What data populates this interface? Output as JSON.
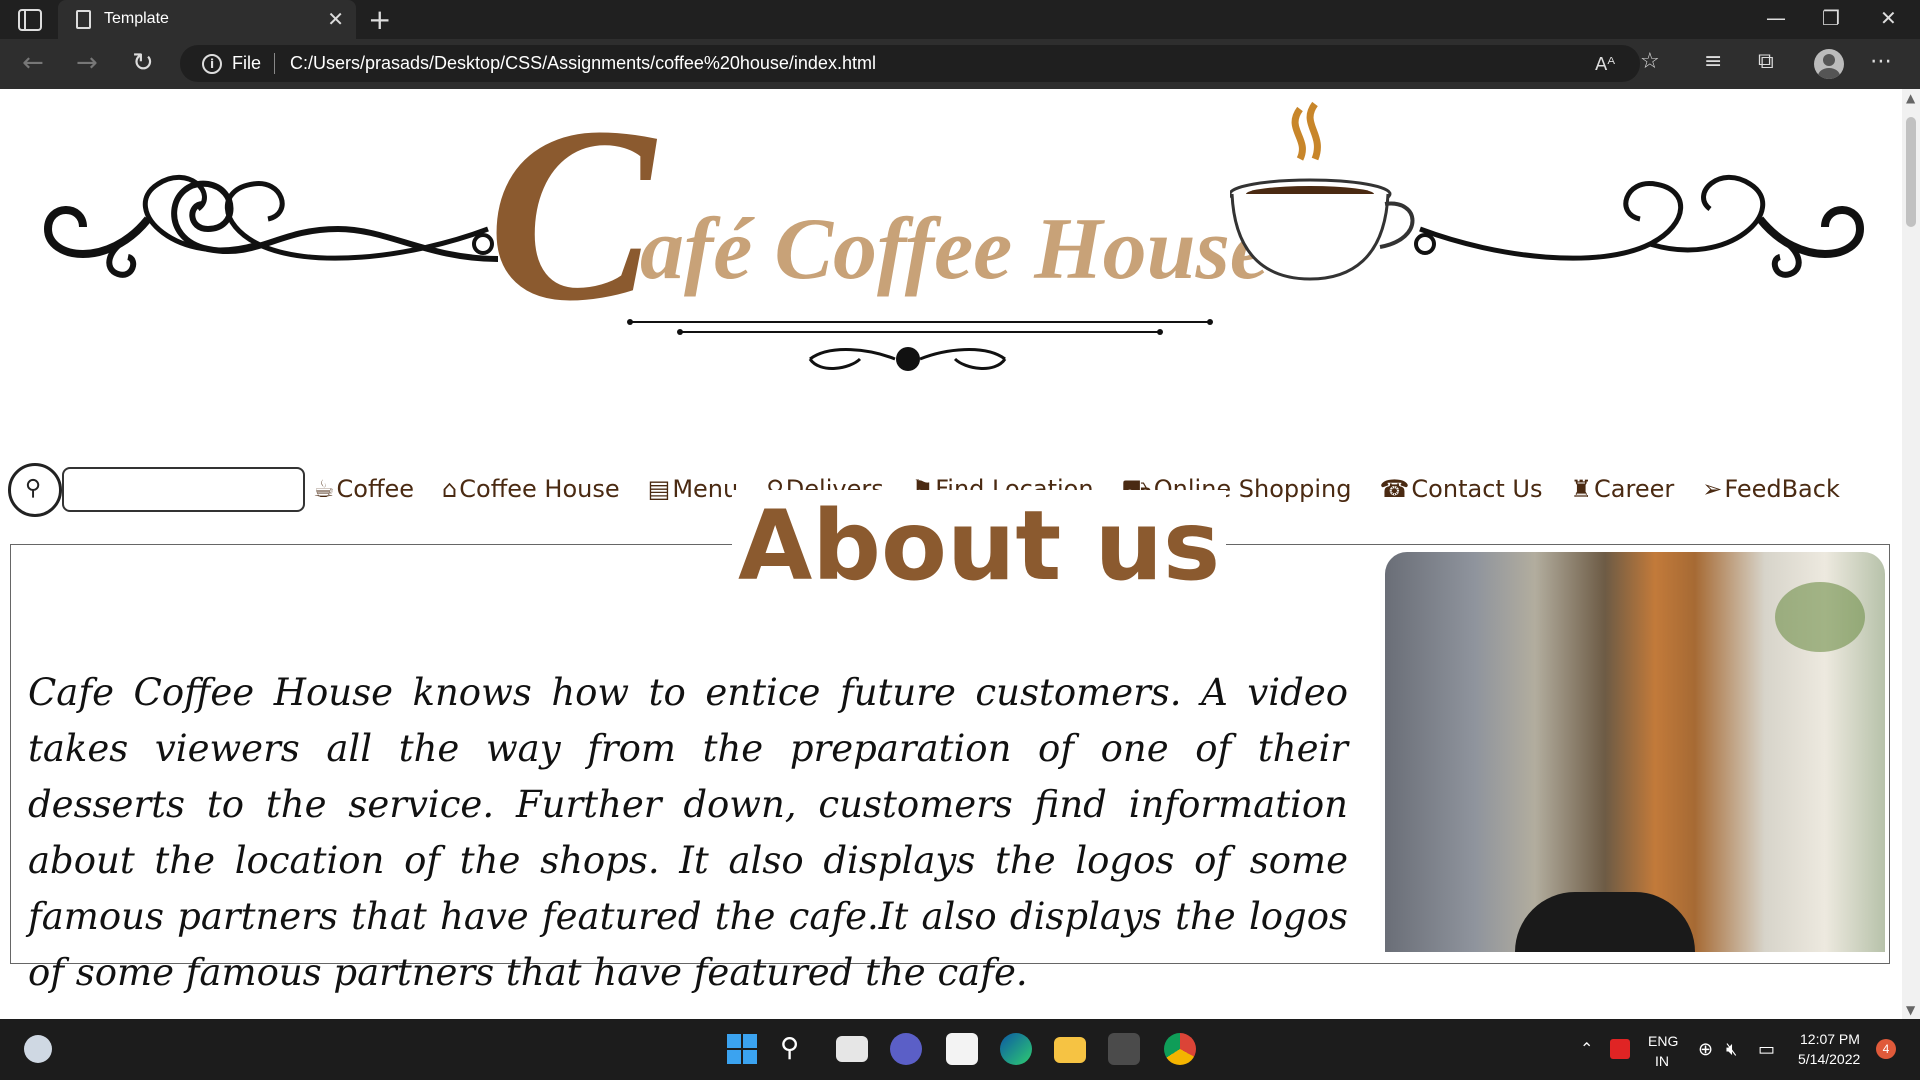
{
  "browser": {
    "tab_title": "Template",
    "tab_close": "✕",
    "new_tab": "+",
    "address_prefix": "File",
    "url": "C:/Users/prasads/Desktop/CSS/Assignments/coffee%20house/index.html",
    "window_controls": {
      "minimize": "—",
      "restore": "❐",
      "close": "✕"
    },
    "toolbar_icons": [
      "read-aloud-icon",
      "add-favorite-icon",
      "favorites-icon",
      "collections-icon",
      "profile-icon",
      "more-icon"
    ]
  },
  "page": {
    "logo": {
      "big_letter": "C",
      "rest_text": "afé Coffee House"
    },
    "search": {
      "placeholder": ""
    },
    "nav": [
      {
        "label": "Coffee",
        "icon": "coffee-mug-icon",
        "glyph": "☕"
      },
      {
        "label": "Coffee House",
        "icon": "store-icon",
        "glyph": "⌂"
      },
      {
        "label": "Menu",
        "icon": "clipboard-icon",
        "glyph": "▤"
      },
      {
        "label": "Delivers",
        "icon": "bicycle-icon",
        "glyph": "⚲"
      },
      {
        "label": "Find Location",
        "icon": "map-marker-icon",
        "glyph": "⚑"
      },
      {
        "label": "Online Shopping",
        "icon": "cart-icon",
        "glyph": "⛟"
      },
      {
        "label": "Contact Us",
        "icon": "contact-card-icon",
        "glyph": "☎"
      },
      {
        "label": "Career",
        "icon": "tie-icon",
        "glyph": "♜"
      },
      {
        "label": "FeedBack",
        "icon": "paper-plane-icon",
        "glyph": "➢"
      }
    ],
    "about": {
      "title": "About us",
      "text": "Cafe Coffee House knows how to entice future customers. A video takes viewers all the way from the preparation of one of their desserts to the service. Further down, customers find information about the location of the shops. It also displays the logos of some famous partners that have featured the cafe.It also displays the logos of some famous partners that have featured the cafe."
    }
  },
  "taskbar": {
    "language": "ENG",
    "region": "IN",
    "time": "12:07 PM",
    "date": "5/14/2022",
    "notification_count": "4"
  },
  "colors": {
    "brand_dark": "#8b5a2f",
    "brand_light": "#c8a278",
    "nav_text": "#4a2a12"
  }
}
